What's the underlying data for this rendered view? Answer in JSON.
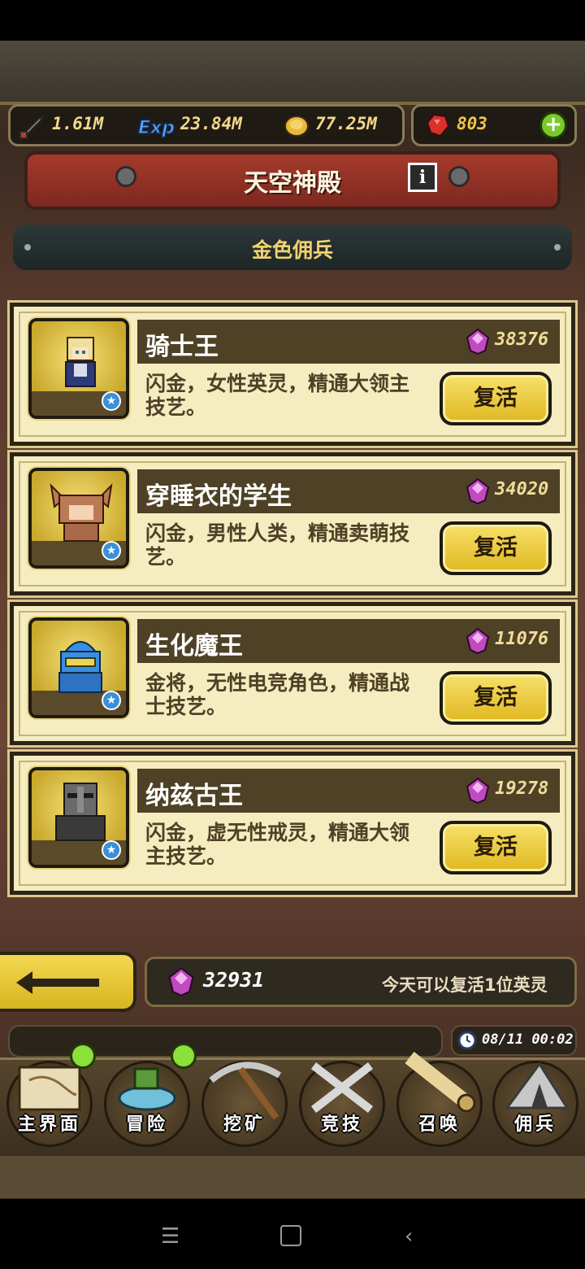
{
  "resources": {
    "sword": "1.61M",
    "exp": "23.84M",
    "gold": "77.25M",
    "ruby": "803"
  },
  "banner": {
    "title": "天空神殿",
    "info": "i"
  },
  "section": {
    "title": "金色佣兵"
  },
  "heroes": [
    {
      "name": "骑士王",
      "price": "38376",
      "desc": "闪金，女性英灵，精通大领主技艺。",
      "button": "复活"
    },
    {
      "name": "穿睡衣的学生",
      "price": "34020",
      "desc": "闪金，男性人类，精通卖萌技艺。",
      "button": "复活"
    },
    {
      "name": "生化魔王",
      "price": "11076",
      "desc": "金将，无性电竞角色，精通战士技艺。",
      "button": "复活"
    },
    {
      "name": "纳兹古王",
      "price": "19278",
      "desc": "闪金，虚无性戒灵，精通大领主技艺。",
      "button": "复活"
    }
  ],
  "footer": {
    "gems": "32931",
    "note": "今天可以复活1位英灵"
  },
  "clock": "08/11 00:02",
  "nav": [
    {
      "label": "主界面"
    },
    {
      "label": "冒险"
    },
    {
      "label": "挖矿"
    },
    {
      "label": "竞技"
    },
    {
      "label": "召唤"
    },
    {
      "label": "佣兵"
    }
  ],
  "colors": {
    "card_bg": "#f5ecc0",
    "button": "#e0b820",
    "banner": "#a53a2c",
    "section_text": "#f0d270"
  }
}
